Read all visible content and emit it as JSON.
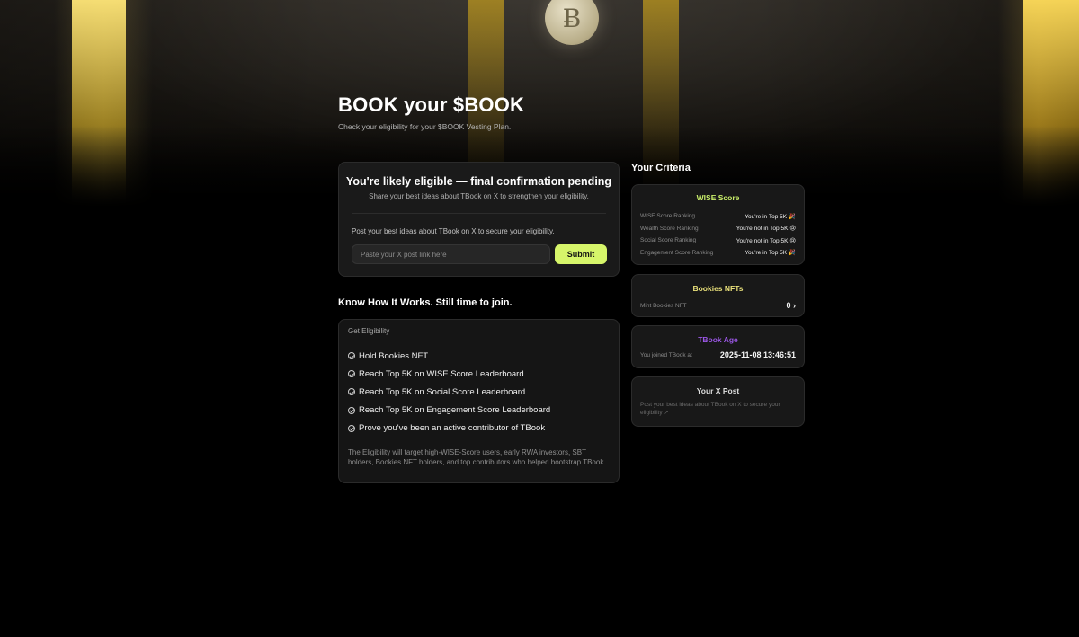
{
  "brand": {
    "logo_glyph": "Ƀ",
    "accent": "#d6f56a",
    "beam_color": "#f0c630"
  },
  "header": {
    "title": "BOOK your $BOOK",
    "subtitle": "Check your eligibility for your $BOOK Vesting Plan."
  },
  "eligibility": {
    "heading": "You're likely eligible — final confirmation pending",
    "subheading": "Share your best ideas about TBook on X to strengthen your eligibility.",
    "prompt": "Post your best ideas about TBook on X to secure your eligibility.",
    "input_value": "",
    "input_placeholder": "Paste your X post link here",
    "submit_label": "Submit"
  },
  "how_it_works": {
    "title": "Know How It Works. Still time to join.",
    "label": "Get Eligibility",
    "items": [
      "Hold Bookies NFT",
      "Reach Top 5K on WISE Score Leaderboard",
      "Reach Top 5K on Social Score Leaderboard",
      "Reach Top 5K on Engagement Score Leaderboard",
      "Prove you've been an active contributor of TBook"
    ],
    "note": "The Eligibility will target high-WISE-Score users, early RWA investors, SBT holders, Bookies NFT holders, and top contributors who helped bootstrap TBook."
  },
  "criteria": {
    "title": "Your Criteria",
    "wise": {
      "heading": "WISE Score",
      "color": "#c9ee6a",
      "rows": [
        {
          "label": "WISE Score Ranking",
          "value": "You're in Top 5K 🎉"
        },
        {
          "label": "Wealth Score Ranking",
          "value": "You're not in Top 5K 😢"
        },
        {
          "label": "Social Score Ranking",
          "value": "You're not in Top 5K 😢"
        },
        {
          "label": "Engagement Score Ranking",
          "value": "You're in Top 5K 🎉"
        }
      ]
    },
    "nfts": {
      "heading": "Bookies NFTs",
      "color": "#e9e07a",
      "label": "Mint Bookies NFT",
      "value": "0 ›"
    },
    "age": {
      "heading": "TBook Age",
      "color": "#9b57e6",
      "label": "You joined TBook at",
      "value": "2025-11-08 13:46:51"
    },
    "xpost": {
      "heading": "Your X Post",
      "text": "Post your best ideas about TBook on X to secure your eligibility ↗"
    }
  }
}
